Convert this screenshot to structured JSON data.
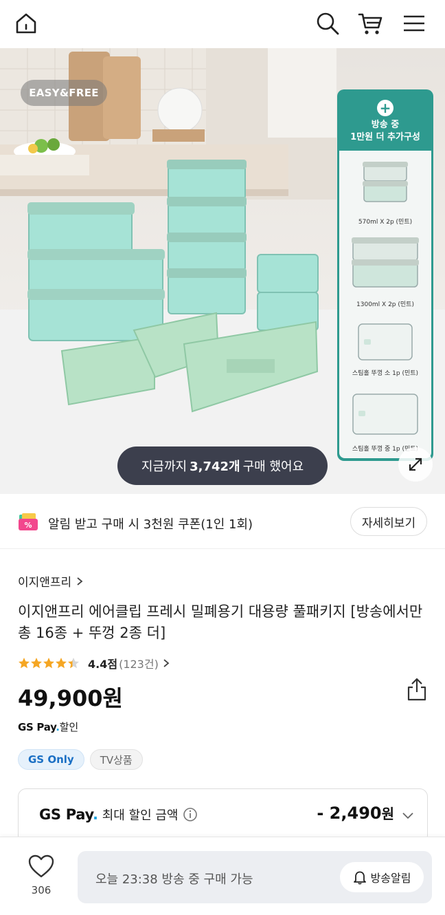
{
  "header": {
    "icons": [
      "home-icon",
      "search-icon",
      "cart-icon",
      "menu-icon"
    ]
  },
  "hero": {
    "brand_badge": "EASY&FREE",
    "bonus_panel": {
      "line1": "방송 중",
      "line2": "1만원 더 추가구성",
      "items": [
        {
          "label": "570ml X 2p (민트)"
        },
        {
          "label": "1300ml X 2p (민트)"
        },
        {
          "label": "스팀홀 뚜껑 소 1p (민트)"
        },
        {
          "label": "스팀홀 뚜껑 중 1p (민트)"
        }
      ]
    },
    "bought": {
      "prefix": "지금까지",
      "count": "3,742개",
      "suffix": "구매 했어요"
    }
  },
  "coupon": {
    "text": "알림 받고 구매 시 3천원 쿠폰",
    "limit": "(1인 1회)",
    "button": "자세히보기"
  },
  "product": {
    "brand": "이지앤프리",
    "title": "이지앤프리 에어클립 프레시 밀폐용기 대용량 풀패키지 [방송에서만 총 16종 + 뚜껑 2종 더]",
    "rating": {
      "stars": 4.4,
      "score": "4.4점",
      "count": "(123건)"
    },
    "price": "49,900원",
    "gspay_logo_main": "GS Pay",
    "gspay_logo_dot": ".",
    "gspay_suffix": "할인",
    "tags": [
      "GS Only",
      "TV상품"
    ]
  },
  "discount": {
    "logo_main": "GS Pay",
    "logo_dot": ".",
    "label": "최대 할인 금액",
    "value": "- 2,490",
    "unit": "원"
  },
  "bottom_bar": {
    "like_count": "306",
    "status": "오늘 23:38 방송 중 구매 가능",
    "alarm_button": "방송알림"
  },
  "colors": {
    "teal_panel": "#2e9a8f",
    "pill_dark": "#3c3f4d",
    "star": "#f5a623",
    "gs_only_blue": "#1a6fc4",
    "gspay_dot": "#1fa3e0"
  }
}
